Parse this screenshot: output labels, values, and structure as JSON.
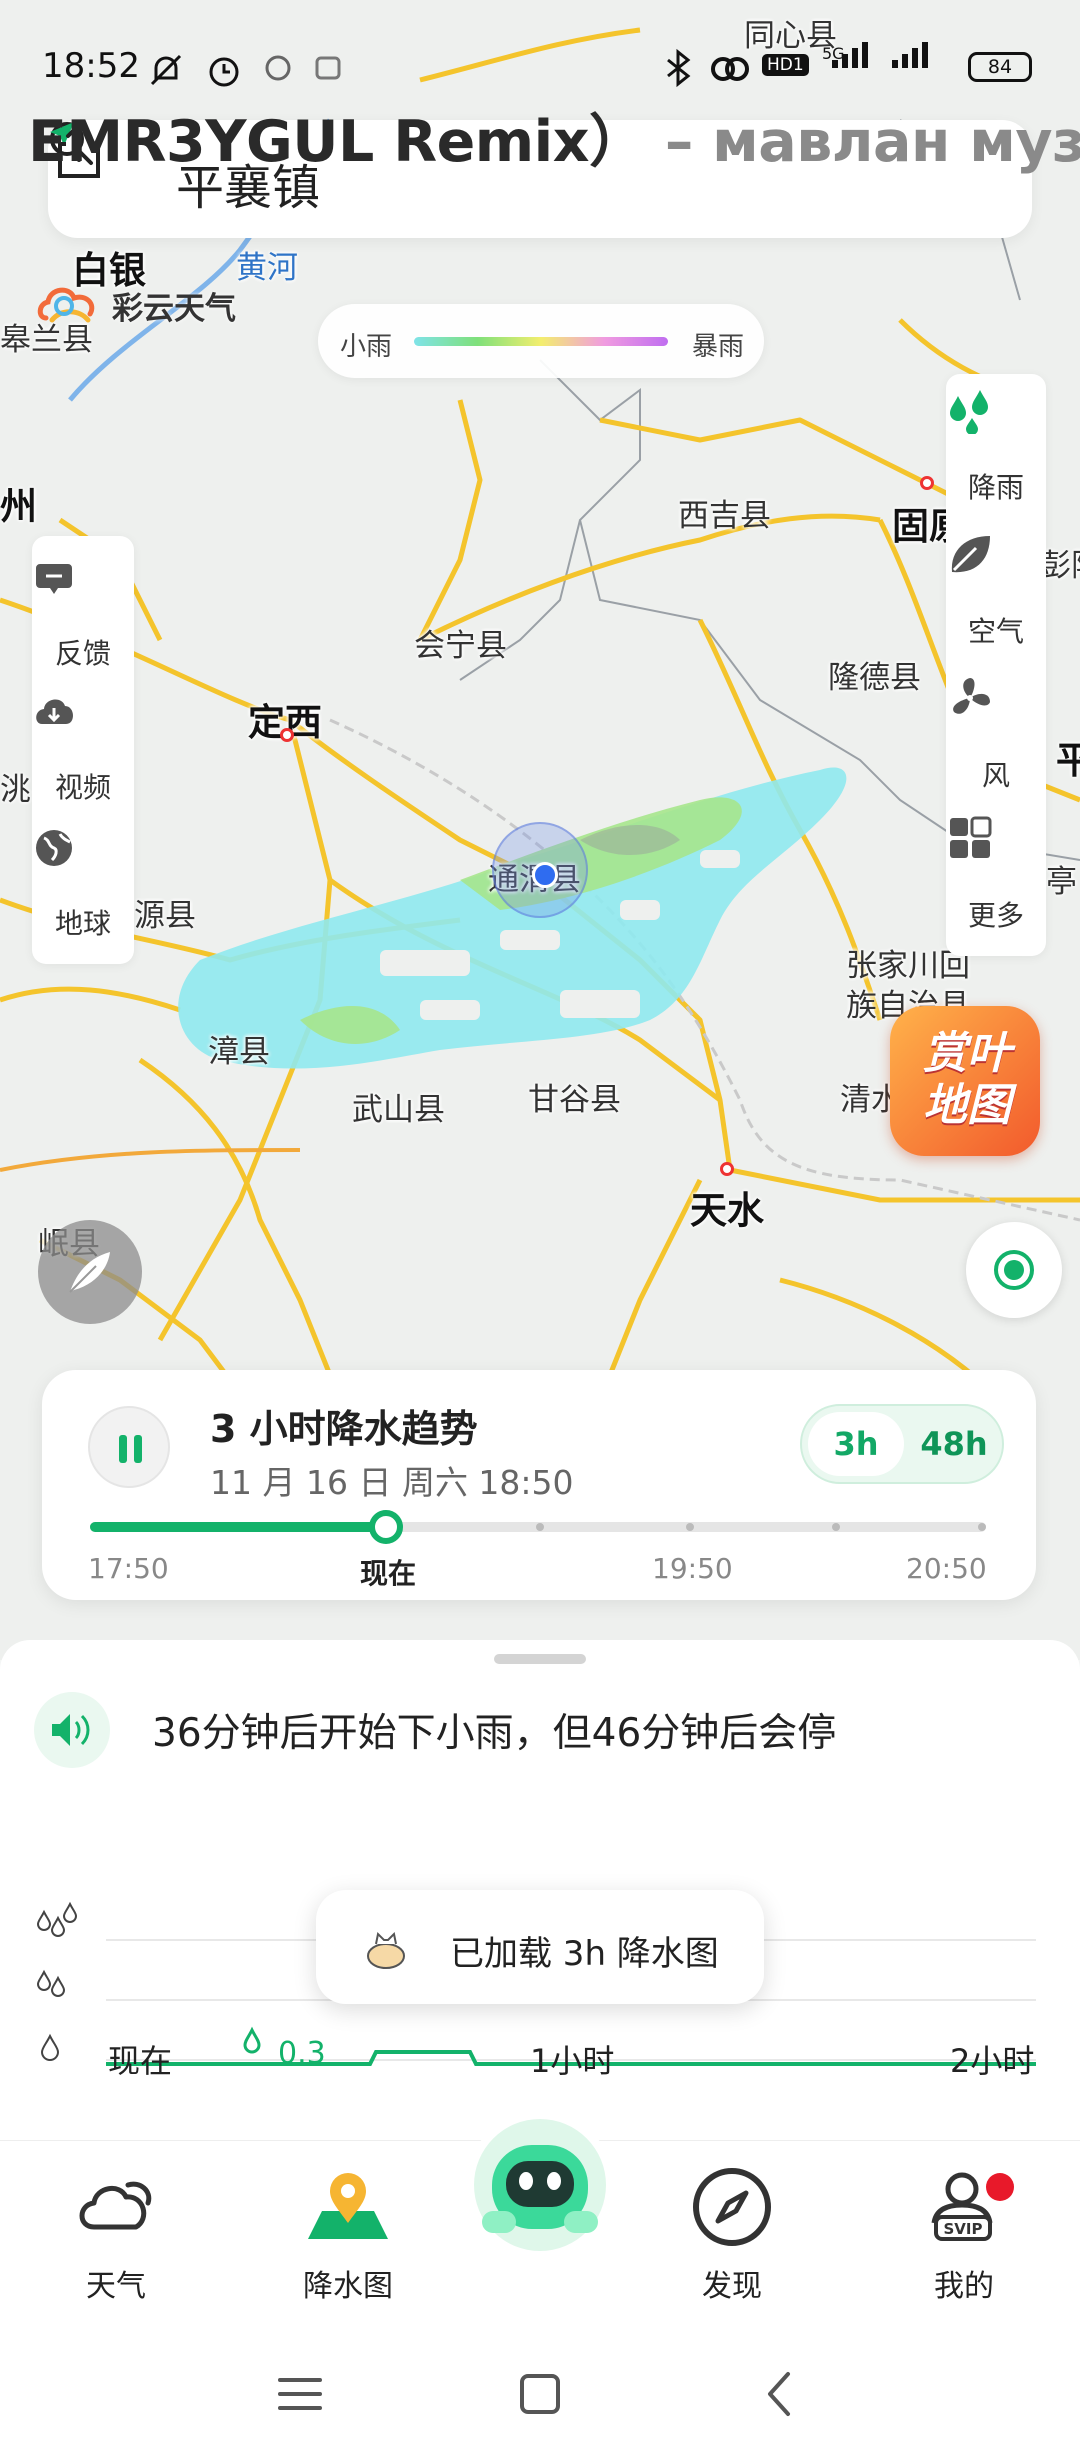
{
  "status_bar": {
    "time": "18:52",
    "hd_label": "HD1",
    "network": "5G",
    "battery": "84"
  },
  "marquee": {
    "text_main": "EMR3YGUL Remix）",
    "text_dim": "– мавлан музыка"
  },
  "search": {
    "location": "平襄镇"
  },
  "brand": {
    "name": "彩云天气"
  },
  "legend": {
    "min_label": "小雨",
    "max_label": "暴雨"
  },
  "map_places": {
    "baiyin": "白银",
    "huanghe": "黄河",
    "gaolan": "皋兰县",
    "tongxin": "同心县",
    "xiji": "西吉县",
    "guyuan": "固原",
    "pengyang": "彭阳",
    "zhou": "州",
    "huining": "会宁县",
    "longde": "隆德县",
    "dingxi": "定西",
    "pingliang": "平",
    "tiaoxian": "洮县",
    "weiyuan": "源县",
    "tongwei": "通渭县",
    "zhangjiachuan_1": "张家川回",
    "zhangjiachuan_2": "族自治县",
    "qingshui": "清水",
    "zhangxian": "漳县",
    "wushan": "武山县",
    "gangu": "甘谷县",
    "tianshui": "天水",
    "minxian": "岷县",
    "zhuang": "亭",
    "huijian": "县"
  },
  "left_panel": {
    "items": [
      {
        "label": "反馈",
        "icon": "feedback-icon"
      },
      {
        "label": "视频",
        "icon": "video-icon"
      },
      {
        "label": "地球",
        "icon": "globe-icon"
      }
    ]
  },
  "right_panel": {
    "items": [
      {
        "label": "降雨",
        "icon": "rain-icon"
      },
      {
        "label": "空气",
        "icon": "leaf-icon"
      },
      {
        "label": "风",
        "icon": "fan-icon"
      },
      {
        "label": "更多",
        "icon": "grid-icon"
      }
    ]
  },
  "leaf_badge": {
    "line1": "赏叶",
    "line2": "地图"
  },
  "trend": {
    "title": "3 小时降水趋势",
    "date": "11 月 16 日 周六 18:50",
    "range_options": [
      "3h",
      "48h"
    ],
    "selected_range": "3h",
    "progress": 0.33,
    "labels": [
      "17:50",
      "现在",
      "19:50",
      "20:50"
    ]
  },
  "forecast": {
    "message": "36分钟后开始下小雨，但46分钟后会停"
  },
  "precip_chart": {
    "value_label": "0.3",
    "x_labels": [
      "现在",
      "1小时",
      "2小时"
    ]
  },
  "toast": {
    "text": "已加载 3h 降水图"
  },
  "bottom_nav": {
    "items": [
      {
        "label": "天气",
        "icon": "cloud-icon"
      },
      {
        "label": "降水图",
        "icon": "map-pin-icon"
      },
      {
        "label": "",
        "icon": "assistant-icon"
      },
      {
        "label": "发现",
        "icon": "compass-icon"
      },
      {
        "label": "我的",
        "icon": "svip-user-icon"
      }
    ]
  },
  "colors": {
    "accent": "#13b26a",
    "rain_light": "#8fe9ee",
    "rain_green": "#a6e58c",
    "road": "#f4c42c"
  }
}
